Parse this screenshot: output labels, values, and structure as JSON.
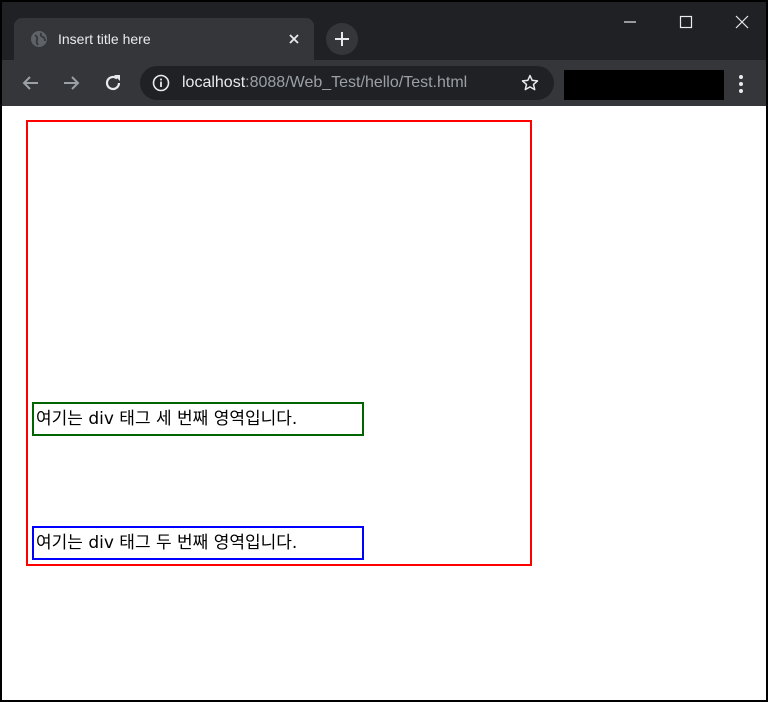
{
  "browser": {
    "tab": {
      "title": "Insert title here"
    },
    "address": {
      "host": "localhost",
      "rest": ":8088/Web_Test/hello/Test.html"
    }
  },
  "page": {
    "div_third": {
      "text": "여기는 div 태그 세 번째 영역입니다."
    },
    "div_second": {
      "text": "여기는 div 태그 두 번째 영역입니다."
    },
    "colors": {
      "outer_border": "#ff0000",
      "third_border": "#006400",
      "second_border": "#0000ff"
    }
  }
}
